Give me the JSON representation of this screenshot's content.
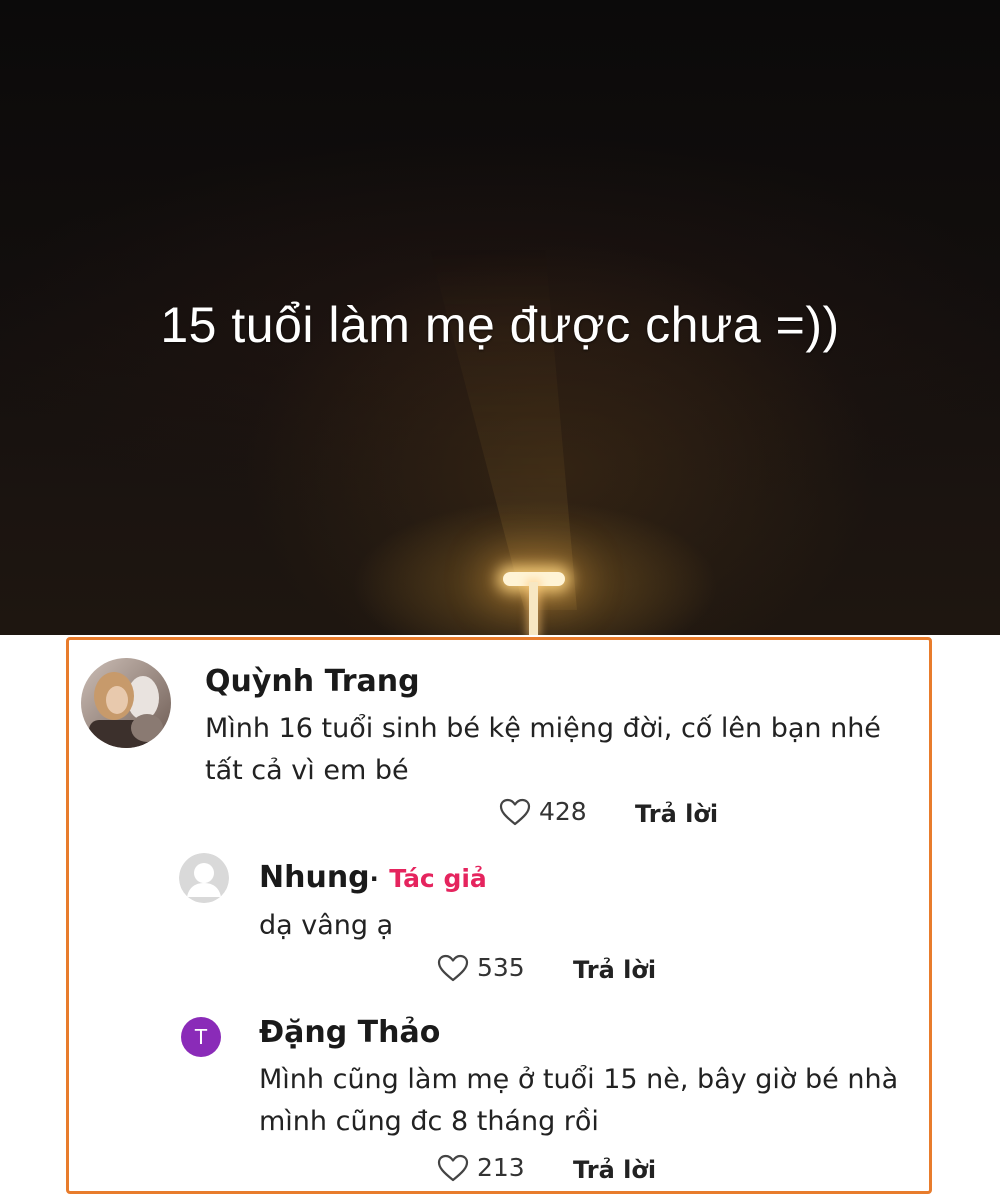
{
  "caption": "15 tuổi làm mẹ được chưa =))",
  "comments": [
    {
      "author": "Quỳnh Trang",
      "text": "Mình 16 tuổi sinh bé kệ miệng đời, cố lên bạn nhé tất cả vì em bé",
      "likes": "428",
      "reply_label": "Trả lời"
    },
    {
      "author": "Nhung",
      "separator": "·",
      "badge": "Tác giả",
      "text": "dạ vâng ạ",
      "likes": "535",
      "reply_label": "Trả lời"
    },
    {
      "author": "Đặng Thảo",
      "avatar_letter": "T",
      "avatar_color": "#8a2bb8",
      "text": "Mình cũng làm mẹ ở tuổi 15 nè, bây giờ bé nhà mình cũng đc 8 tháng rồi",
      "likes": "213",
      "reply_label": "Trả lời"
    }
  ],
  "colors": {
    "panel_border": "#e87c2c",
    "author_badge": "#e5245e"
  }
}
